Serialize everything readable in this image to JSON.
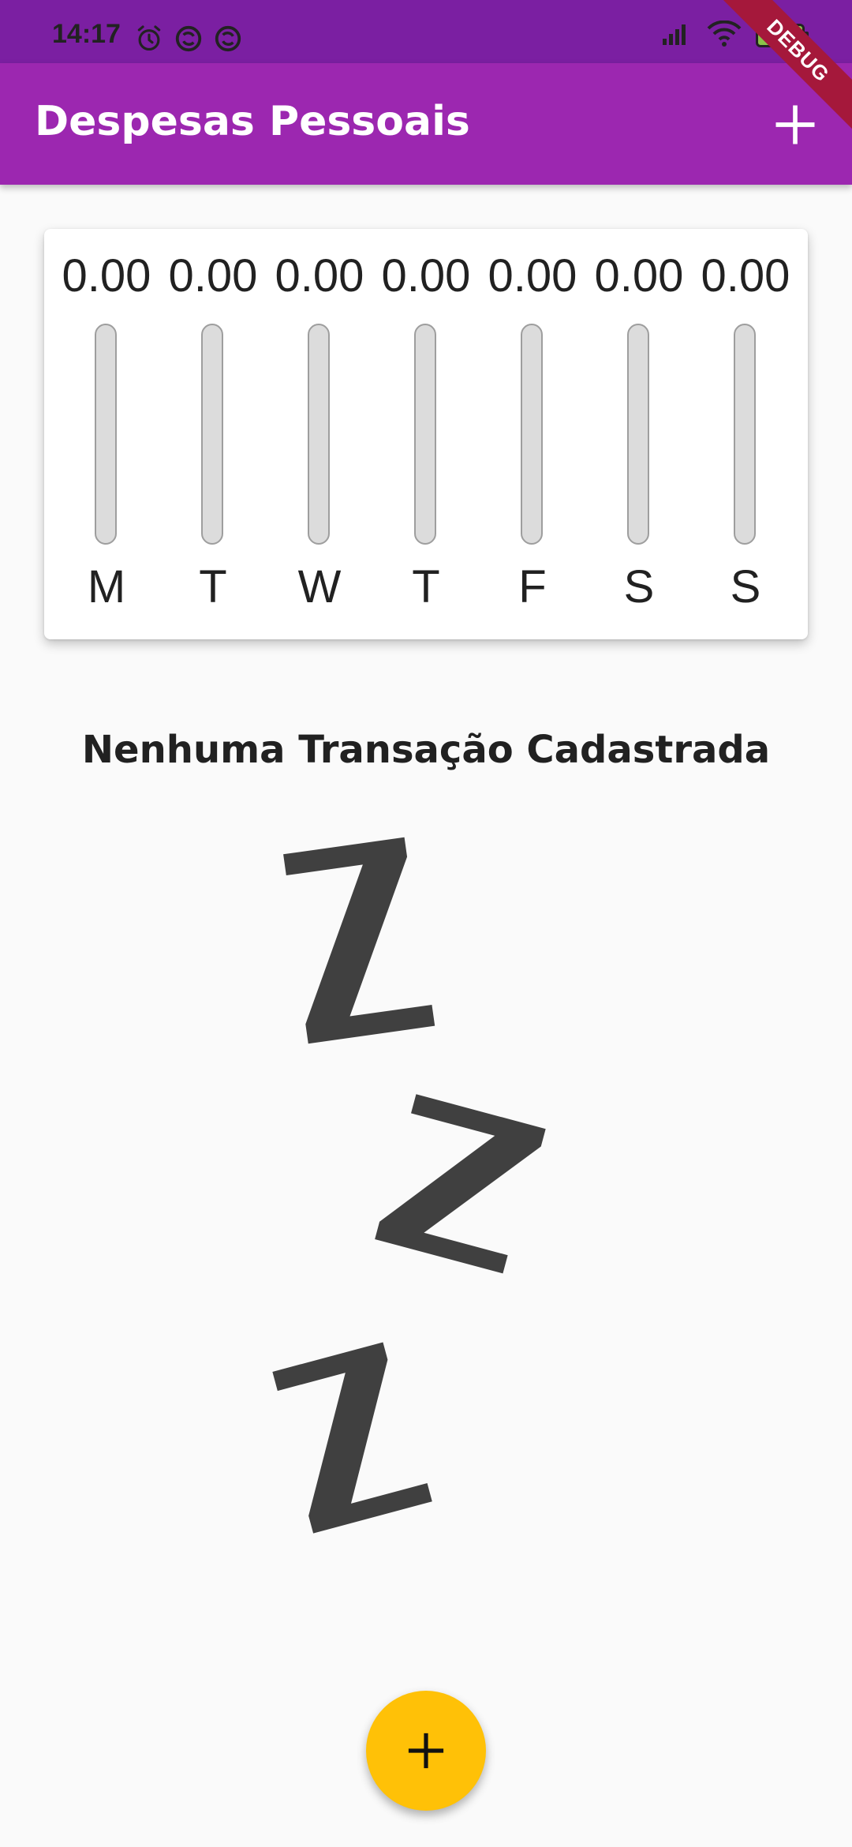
{
  "status_bar": {
    "time": "14:17",
    "battery_level": "99",
    "icons": [
      "alarm-icon",
      "sync-icon",
      "sync-icon",
      "signal-icon",
      "wifi-icon",
      "battery-icon"
    ]
  },
  "debug_banner": "DEBUG",
  "app_bar": {
    "title": "Despesas Pessoais",
    "action_icon": "add-icon",
    "background_color": "#9c27b0"
  },
  "chart": {
    "days": [
      {
        "day": "M",
        "value": "0.00",
        "percent": 0
      },
      {
        "day": "T",
        "value": "0.00",
        "percent": 0
      },
      {
        "day": "W",
        "value": "0.00",
        "percent": 0
      },
      {
        "day": "T",
        "value": "0.00",
        "percent": 0
      },
      {
        "day": "F",
        "value": "0.00",
        "percent": 0
      },
      {
        "day": "S",
        "value": "0.00",
        "percent": 0
      },
      {
        "day": "S",
        "value": "0.00",
        "percent": 0
      }
    ]
  },
  "empty_state": {
    "message": "Nenhuma Transação Cadastrada",
    "image_icon": "sleeping-zzz-icon"
  },
  "fab": {
    "icon": "add-icon",
    "color": "#ffc107"
  }
}
